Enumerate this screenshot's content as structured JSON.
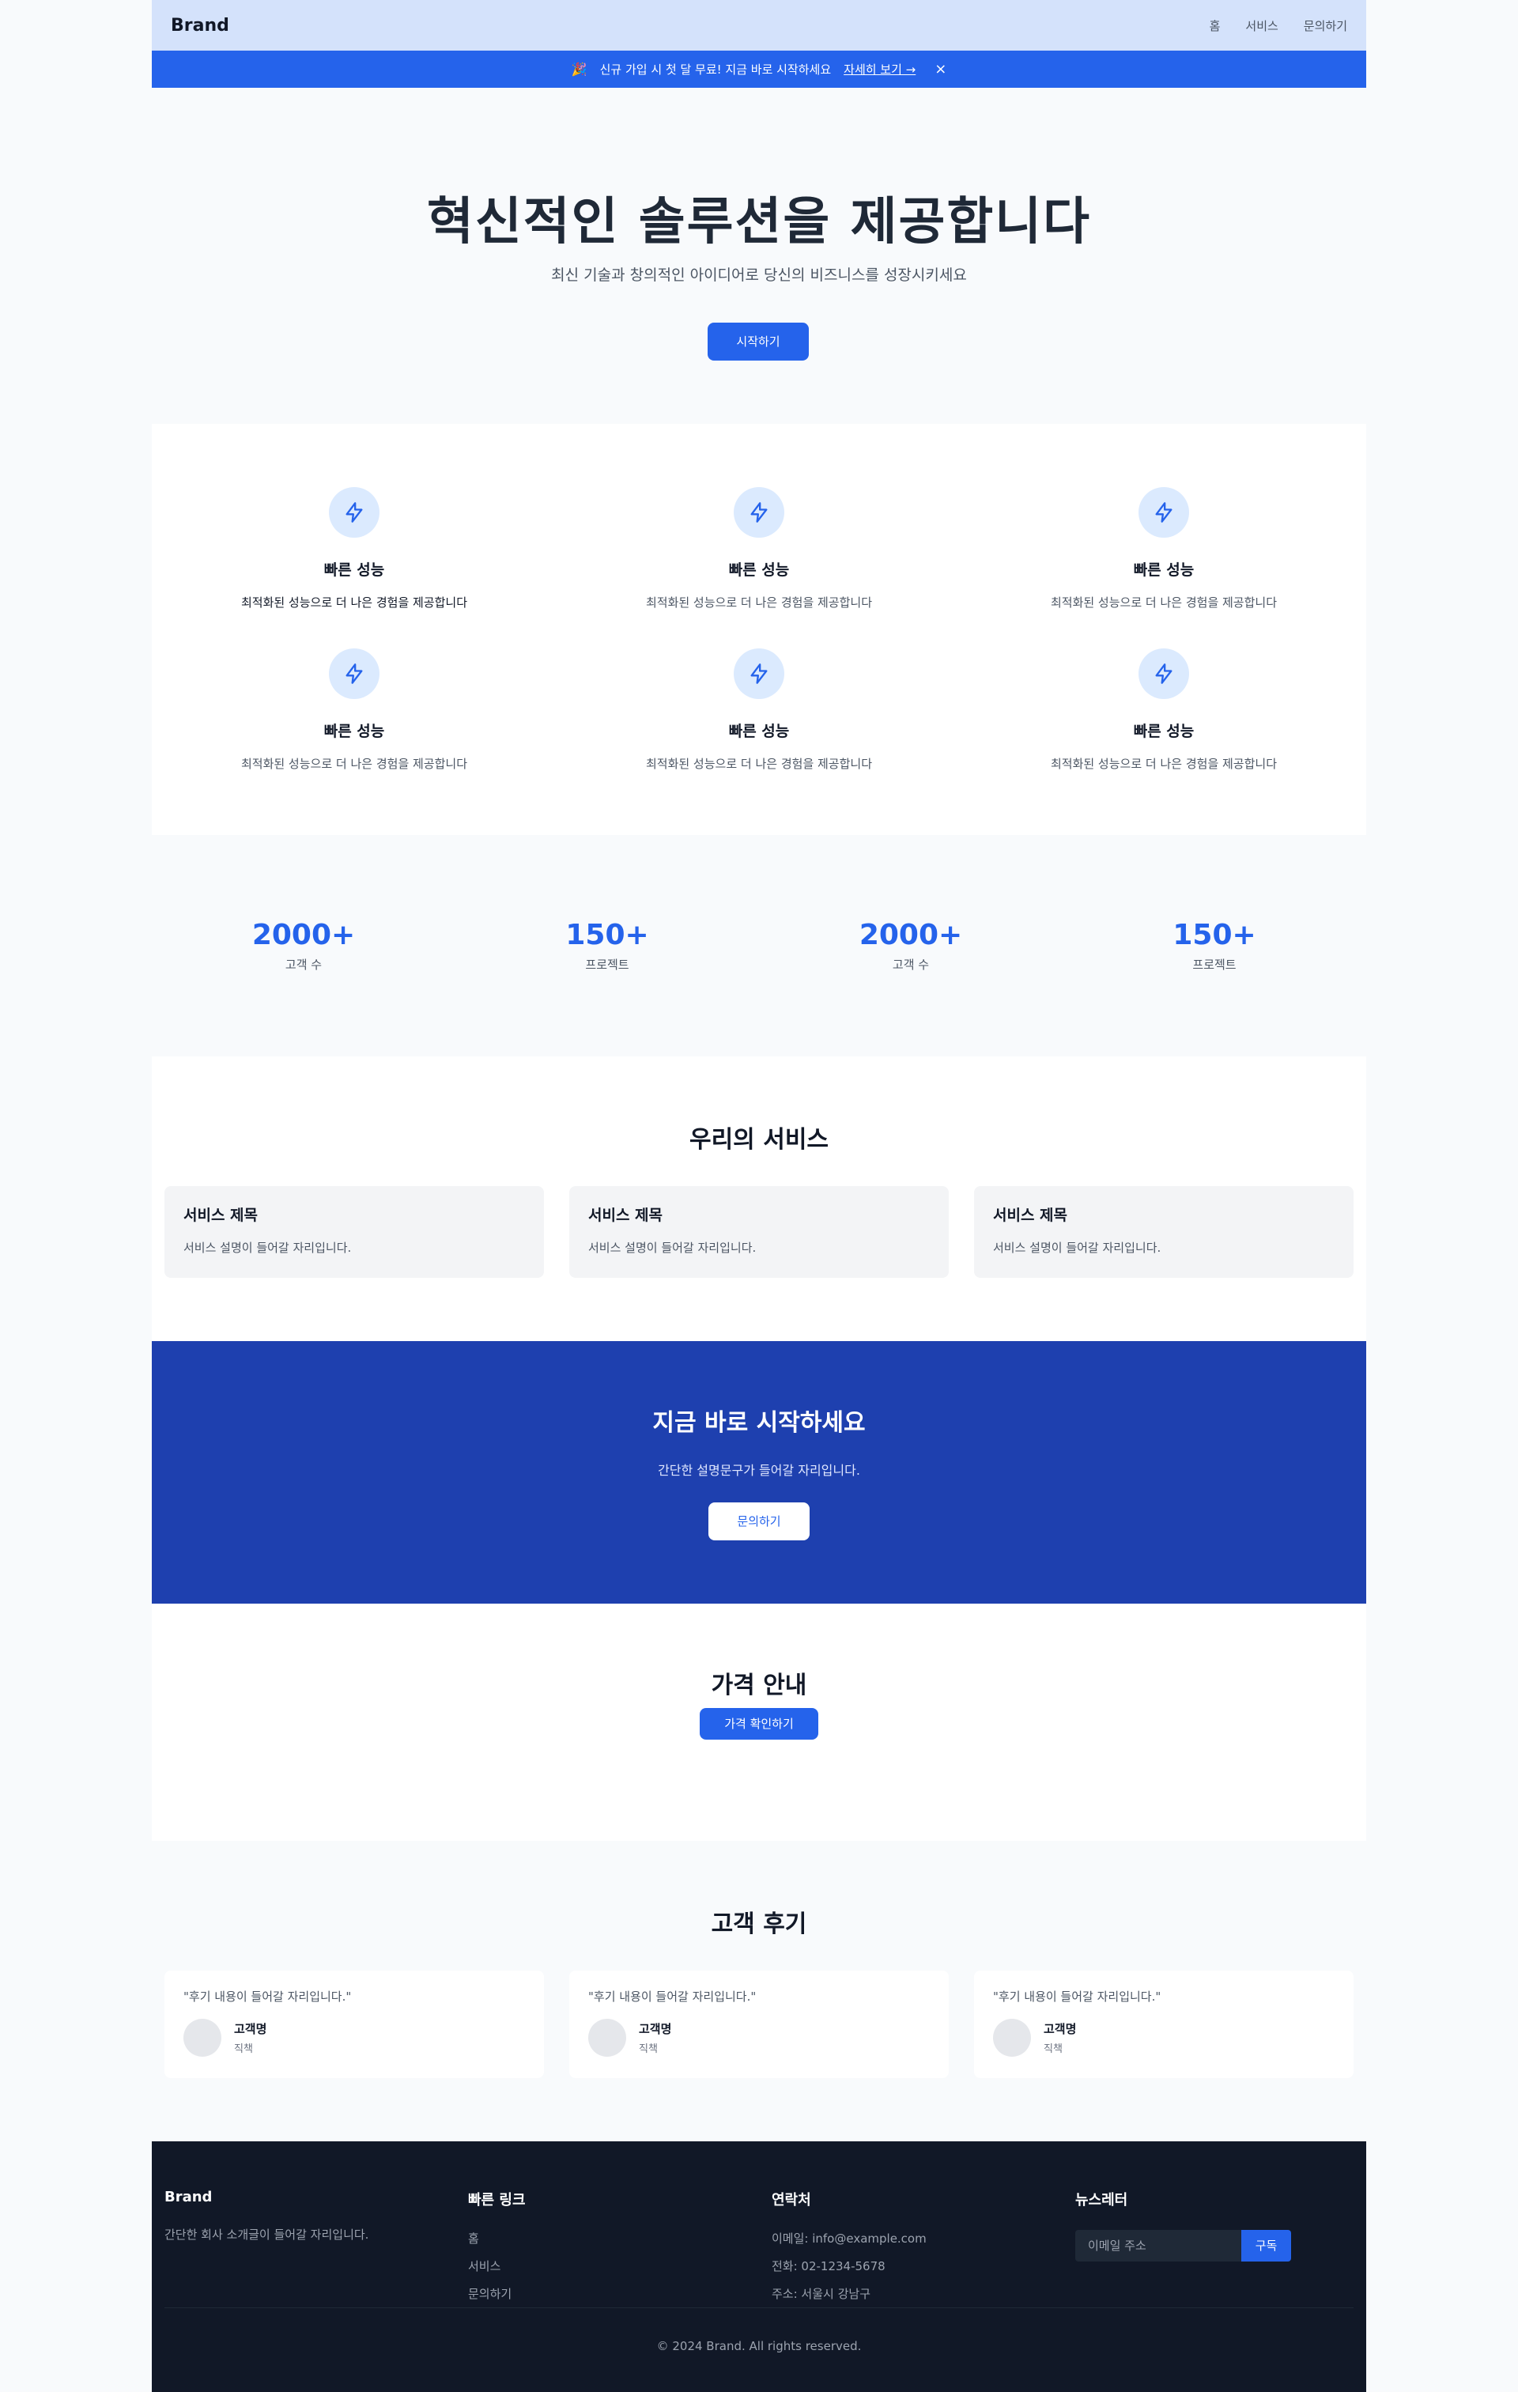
{
  "header": {
    "brand": "Brand",
    "nav": [
      "홈",
      "서비스",
      "문의하기"
    ]
  },
  "banner": {
    "icon": "party-popper-icon",
    "text": "신규 가입 시 첫 달 무료! 지금 바로 시작하세요",
    "link": "자세히 보기 →",
    "close": "×"
  },
  "hero": {
    "title": "혁신적인 솔루션을 제공합니다",
    "subtitle": "최신 기술과 창의적인 아이디어로 당신의 비즈니스를 성장시키세요",
    "cta": "시작하기"
  },
  "features": {
    "icon": "lightning-icon",
    "items": [
      {
        "title": "빠른 성능",
        "desc": "최적화된 성능으로 더 나은 경험을 제공합니다"
      },
      {
        "title": "빠른 성능",
        "desc": "최적화된 성능으로 더 나은 경험을 제공합니다"
      },
      {
        "title": "빠른 성능",
        "desc": "최적화된 성능으로 더 나은 경험을 제공합니다"
      },
      {
        "title": "빠른 성능",
        "desc": "최적화된 성능으로 더 나은 경험을 제공합니다"
      },
      {
        "title": "빠른 성능",
        "desc": "최적화된 성능으로 더 나은 경험을 제공합니다"
      },
      {
        "title": "빠른 성능",
        "desc": "최적화된 성능으로 더 나은 경험을 제공합니다"
      }
    ]
  },
  "stats": [
    {
      "num": "2000+",
      "label": "고객 수"
    },
    {
      "num": "150+",
      "label": "프로젝트"
    },
    {
      "num": "2000+",
      "label": "고객 수"
    },
    {
      "num": "150+",
      "label": "프로젝트"
    }
  ],
  "services": {
    "title": "우리의 서비스",
    "cards": [
      {
        "title": "서비스 제목",
        "desc": "서비스 설명이 들어갈 자리입니다."
      },
      {
        "title": "서비스 제목",
        "desc": "서비스 설명이 들어갈 자리입니다."
      },
      {
        "title": "서비스 제목",
        "desc": "서비스 설명이 들어갈 자리입니다."
      }
    ]
  },
  "cta": {
    "title": "지금 바로 시작하세요",
    "desc": "간단한 설명문구가 들어갈 자리입니다.",
    "button": "문의하기"
  },
  "pricing": {
    "title": "가격 안내",
    "button": "가격 확인하기"
  },
  "testimonials": {
    "title": "고객 후기",
    "cards": [
      {
        "quote": "\"후기 내용이 들어갈 자리입니다.\"",
        "name": "고객명",
        "role": "직책"
      },
      {
        "quote": "\"후기 내용이 들어갈 자리입니다.\"",
        "name": "고객명",
        "role": "직책"
      },
      {
        "quote": "\"후기 내용이 들어갈 자리입니다.\"",
        "name": "고객명",
        "role": "직책"
      }
    ]
  },
  "footer": {
    "brand": "Brand",
    "about": "간단한 회사 소개글이 들어갈 자리입니다.",
    "links_title": "빠른 링크",
    "links": [
      "홈",
      "서비스",
      "문의하기"
    ],
    "contact_title": "연락처",
    "contact": [
      "이메일: info@example.com",
      "전화: 02-1234-5678",
      "주소: 서울시 강남구"
    ],
    "newsletter_title": "뉴스레터",
    "newsletter_placeholder": "이메일 주소",
    "subscribe": "구독",
    "copyright": "© 2024 Brand. All rights reserved."
  },
  "colors": {
    "primary": "#2563eb",
    "dark_blue": "#1e40af",
    "header_bg": "#d4e2fb",
    "footer_bg": "#111827"
  }
}
